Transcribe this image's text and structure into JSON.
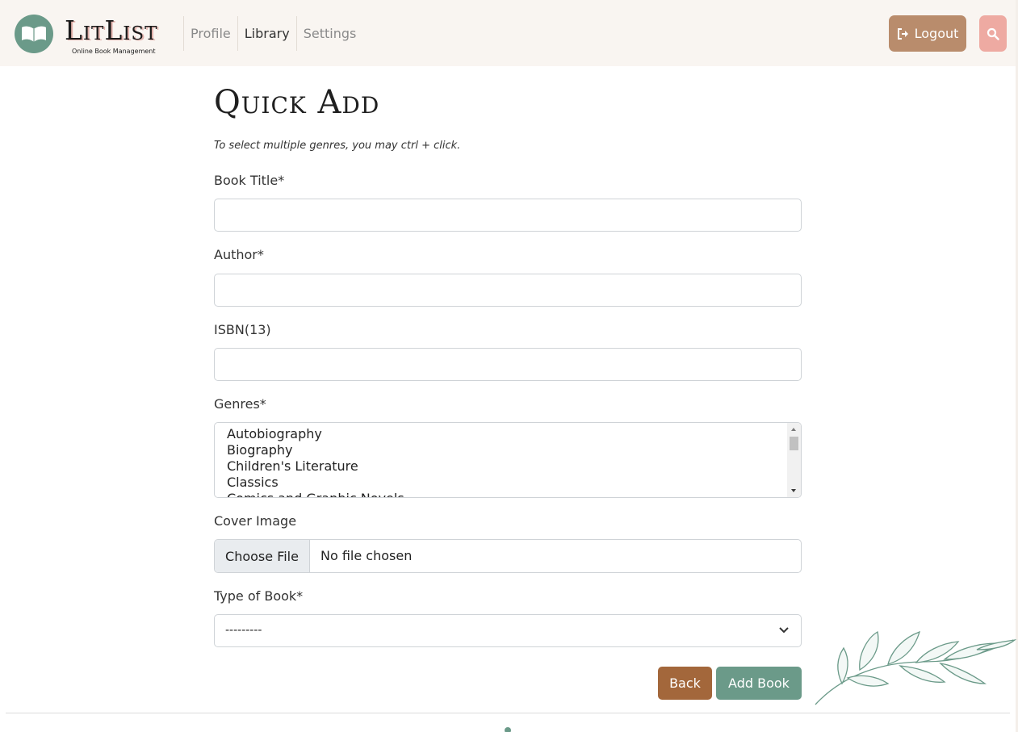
{
  "header": {
    "brand_name": "LitList",
    "brand_tagline": "Online Book Management",
    "logo_icon": "open-book-icon",
    "nav": [
      {
        "label": "Profile",
        "active": false
      },
      {
        "label": "Library",
        "active": true
      },
      {
        "label": "Settings",
        "active": false
      }
    ],
    "logout_label": "Logout",
    "logout_icon": "sign-out-icon",
    "search_icon": "search-icon"
  },
  "form": {
    "title": "Quick Add",
    "hint": "To select multiple genres, you may ctrl + click.",
    "book_title": {
      "label": "Book Title*",
      "value": ""
    },
    "author": {
      "label": "Author*",
      "value": ""
    },
    "isbn": {
      "label": "ISBN(13)",
      "value": ""
    },
    "genres": {
      "label": "Genres*",
      "options": [
        "Autobiography",
        "Biography",
        "Children's Literature",
        "Classics",
        "Comics and Graphic Novels"
      ]
    },
    "cover_image": {
      "label": "Cover Image",
      "button": "Choose File",
      "status": "No file chosen"
    },
    "type_of_book": {
      "label": "Type of Book*",
      "selected": "---------"
    },
    "back_label": "Back",
    "add_label": "Add Book"
  },
  "colors": {
    "accent_green": "#6b9a89",
    "logout_tan": "#b98c6c",
    "search_pink": "#eeaaa2",
    "back_brown": "#a3673b"
  }
}
